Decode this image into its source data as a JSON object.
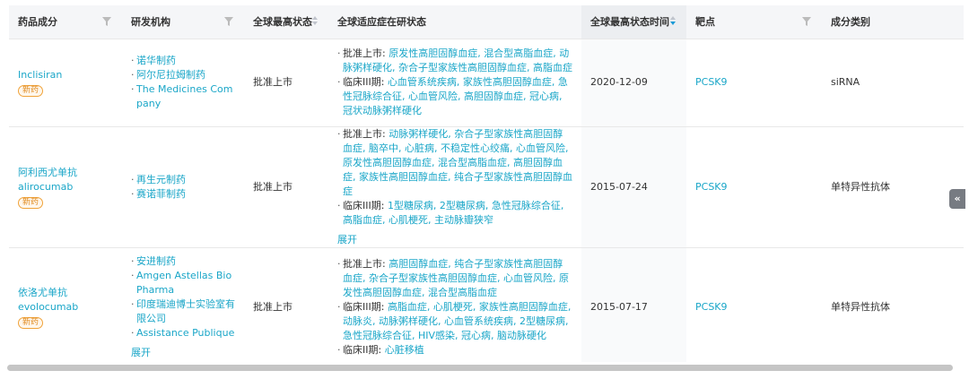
{
  "columns": {
    "drug": "药品成分",
    "org": "研发机构",
    "status": "全球最高状态",
    "indications": "全球适应症在研状态",
    "time": "全球最高状态时间",
    "target": "靶点",
    "category": "成分类别"
  },
  "rows": [
    {
      "drug_name": "Inclisiran",
      "badge": "新药",
      "orgs": [
        "诺华制药",
        "阿尔尼拉姆制药",
        "The Medicines Company"
      ],
      "status": "批准上市",
      "indications": [
        {
          "label": "批准上市: ",
          "text": "原发性高胆固醇血症, 混合型高脂血症, 动脉粥样硬化, 杂合子型家族性高胆固醇血症, 高脂血症"
        },
        {
          "label": "临床III期: ",
          "text": "心血管系统疾病, 家族性高胆固醇血症, 急性冠脉综合征, 心血管风险, 高胆固醇血症, 冠心病, 冠状动脉粥样硬化"
        }
      ],
      "time": "2020-12-09",
      "target": "PCSK9",
      "category": "siRNA"
    },
    {
      "drug_name": "阿利西尤单抗\nalirocumab",
      "badge": "新药",
      "orgs": [
        "再生元制药",
        "赛诺菲制药"
      ],
      "status": "批准上市",
      "indications": [
        {
          "label": "批准上市: ",
          "text": "动脉粥样硬化, 杂合子型家族性高胆固醇血症, 脑卒中, 心脏病, 不稳定性心绞痛, 心血管风险, 原发性高胆固醇血症, 混合型高脂血症, 高胆固醇血症, 家族性高胆固醇血症, 纯合子型家族性高胆固醇血症"
        },
        {
          "label": "临床III期: ",
          "text": "1型糖尿病, 2型糖尿病, 急性冠脉综合征, 高脂血症, 心肌梗死, 主动脉瓣狭窄"
        }
      ],
      "expand": "展开",
      "time": "2015-07-24",
      "target": "PCSK9",
      "category": "单特异性抗体"
    },
    {
      "drug_name": "依洛尤单抗\nevolocumab",
      "badge": "新药",
      "orgs": [
        "安进制药",
        "Amgen Astellas BioPharma",
        "印度瑞迪博士实验室有限公司",
        "Assistance Publique"
      ],
      "orgs_expand": "展开",
      "status": "批准上市",
      "indications": [
        {
          "label": "批准上市: ",
          "text": "高胆固醇血症, 纯合子型家族性高胆固醇血症, 杂合子型家族性高胆固醇血症, 心血管风险, 原发性高胆固醇血症, 混合型高脂血症"
        },
        {
          "label": "临床III期: ",
          "text": "高脂血症, 心肌梗死, 家族性高胆固醇血症, 动脉炎, 动脉粥样硬化, 心血管系统疾病, 2型糖尿病, 急性冠脉综合征, HIV感染, 冠心病, 脑动脉硬化"
        },
        {
          "label": "临床II期: ",
          "text": "心脏移植"
        }
      ],
      "time": "2015-07-17",
      "target": "PCSK9",
      "category": "单特异性抗体"
    }
  ],
  "collapse_icon": "«",
  "colors": {
    "link": "#1aa6c8",
    "badge": "#e08a1e",
    "sort_active": "#1b9bd7"
  }
}
